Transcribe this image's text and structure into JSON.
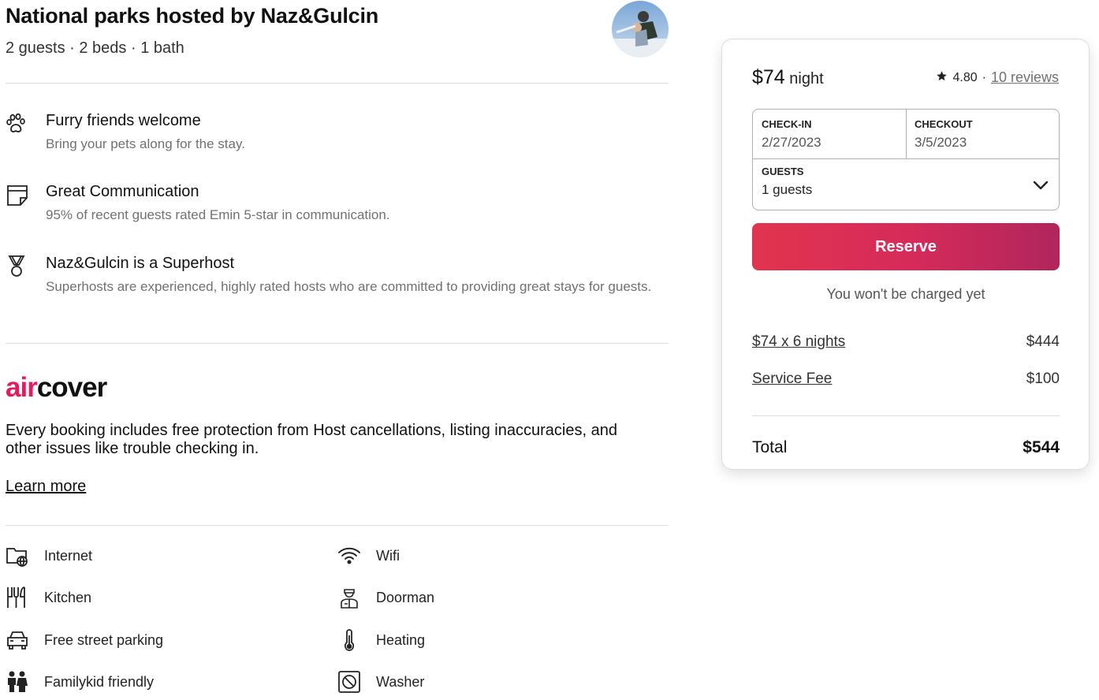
{
  "listing": {
    "title": "National parks hosted by Naz&Gulcin",
    "details": "2 guests · 2 beds · 1 bath"
  },
  "features": [
    {
      "icon": "paw-icon",
      "title": "Furry friends welcome",
      "description": "Bring your pets along for the stay."
    },
    {
      "icon": "calendar-note-icon",
      "title": "Great Communication",
      "description": "95% of recent guests rated Emin 5-star in communication."
    },
    {
      "icon": "superhost-medal-icon",
      "title": "Naz&Gulcin is a Superhost",
      "description": "Superhosts are experienced, highly rated hosts who are committed to providing great stays for guests."
    }
  ],
  "aircover": {
    "logo_air": "air",
    "logo_cover": "cover",
    "description": "Every booking includes free protection from Host cancellations, listing inaccuracies, and other issues like trouble checking in.",
    "learn_more": "Learn more",
    "brand_color": "#e31c5f"
  },
  "amenities": [
    {
      "icon": "internet-folder-icon",
      "label": "Internet"
    },
    {
      "icon": "wifi-icon",
      "label": "Wifi"
    },
    {
      "icon": "kitchen-utensils-icon",
      "label": "Kitchen"
    },
    {
      "icon": "doorman-icon",
      "label": "Doorman"
    },
    {
      "icon": "car-icon",
      "label": "Free street parking"
    },
    {
      "icon": "thermometer-icon",
      "label": "Heating"
    },
    {
      "icon": "family-icon",
      "label": "Familykid friendly"
    },
    {
      "icon": "washer-icon",
      "label": "Washer"
    }
  ],
  "booking": {
    "price": "$74",
    "per": "night",
    "rating": "4.80",
    "separator": "·",
    "reviews": "10 reviews",
    "checkin_label": "CHECK-IN",
    "checkin_value": "2/27/2023",
    "checkout_label": "CHECKOUT",
    "checkout_value": "3/5/2023",
    "guests_label": "GUESTS",
    "guests_value": "1 guests",
    "reserve_label": "Reserve",
    "no_charge": "You won't be charged yet",
    "line_items": [
      {
        "label": "$74 x 6 nights",
        "value": "$444"
      },
      {
        "label": "Service Fee",
        "value": "$100"
      }
    ],
    "total_label": "Total",
    "total_value": "$544",
    "accent_color": "#e1344f"
  }
}
